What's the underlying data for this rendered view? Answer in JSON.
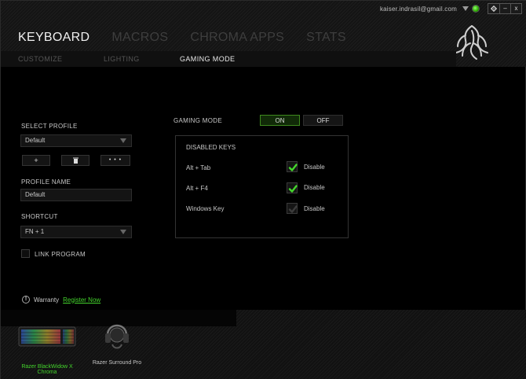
{
  "titlebar": {
    "account": "kaiser.indrasil@gmail.com",
    "settings_icon": "gear-icon",
    "minimize_label": "–",
    "close_label": "x"
  },
  "main_tabs": [
    {
      "label": "KEYBOARD",
      "active": true
    },
    {
      "label": "MACROS",
      "active": false
    },
    {
      "label": "CHROMA APPS",
      "active": false
    },
    {
      "label": "STATS",
      "active": false
    }
  ],
  "sub_tabs": [
    {
      "label": "CUSTOMIZE",
      "active": false
    },
    {
      "label": "LIGHTING",
      "active": false
    },
    {
      "label": "GAMING MODE",
      "active": true
    }
  ],
  "profile": {
    "select_label": "SELECT PROFILE",
    "selected": "Default",
    "add_label": "+",
    "delete_icon": "trash-icon",
    "more_label": "• • •",
    "name_label": "PROFILE NAME",
    "name_value": "Default",
    "shortcut_label": "SHORTCUT",
    "shortcut_value": "FN + 1",
    "link_label": "LINK PROGRAM"
  },
  "gaming_mode": {
    "label": "GAMING MODE",
    "on_label": "ON",
    "off_label": "OFF",
    "state": "on"
  },
  "disabled_keys": {
    "title": "DISABLED KEYS",
    "items": [
      {
        "key": "Alt + Tab",
        "option": "Disable",
        "checked": true
      },
      {
        "key": "Alt + F4",
        "option": "Disable",
        "checked": true
      },
      {
        "key": "Windows Key",
        "option": "Disable",
        "checked": false
      }
    ]
  },
  "warranty": {
    "label": "Warranty",
    "link": "Register Now"
  },
  "devices": [
    {
      "name_line1": "Razer BlackWidow X",
      "name_line2": "Chroma",
      "active": true
    },
    {
      "name_line1": "Razer Surround Pro",
      "name_line2": "",
      "active": false
    }
  ],
  "colors": {
    "accent": "#44d62c",
    "background": "#000000"
  }
}
